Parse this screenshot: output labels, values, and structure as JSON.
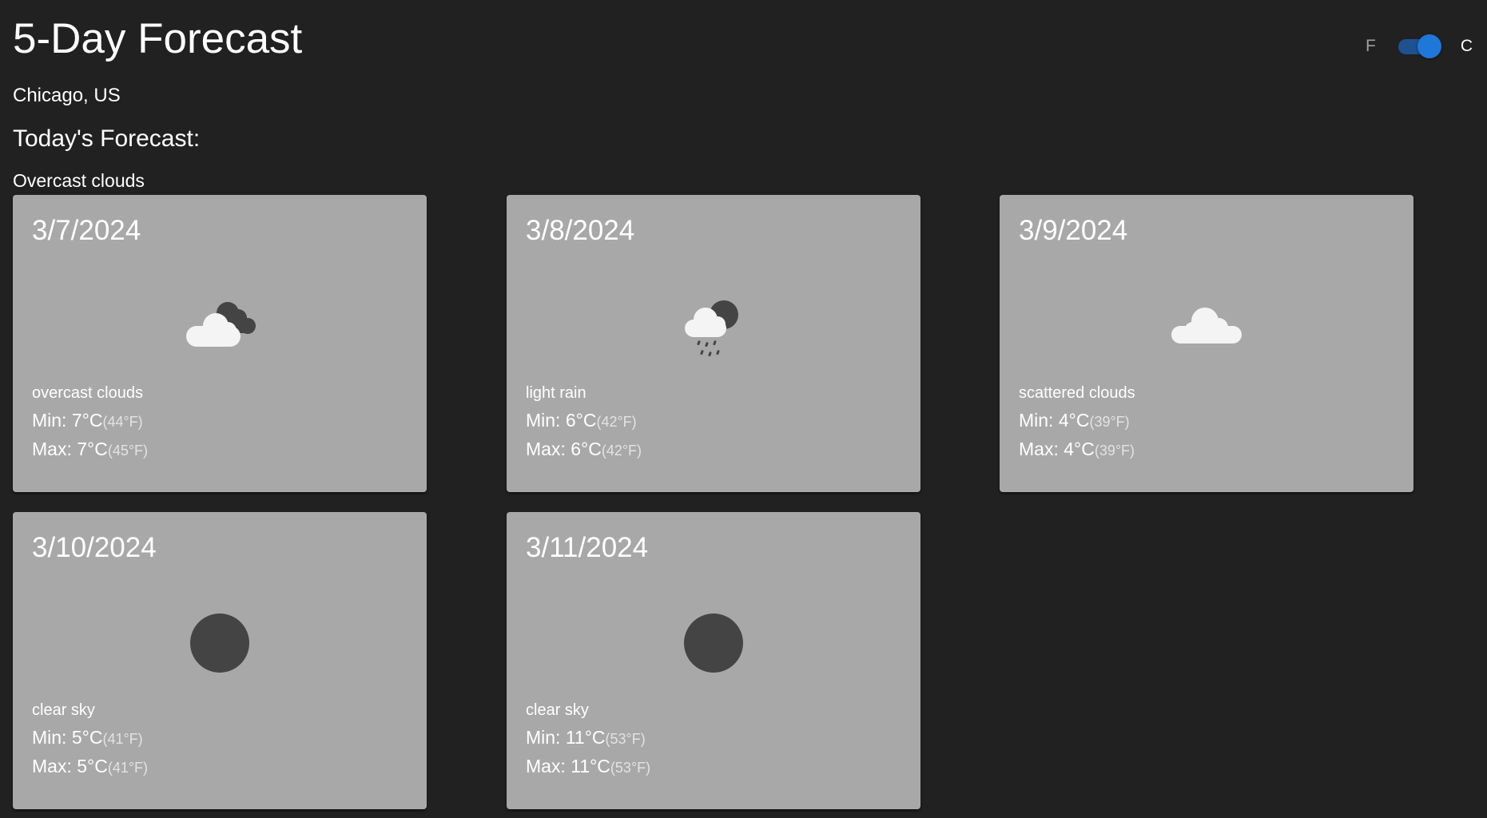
{
  "header": {
    "title": "5-Day Forecast",
    "location": "Chicago, US",
    "today_heading": "Today's Forecast:",
    "today_description": "Overcast clouds"
  },
  "unit_toggle": {
    "left_label": "F",
    "right_label": "C",
    "selected": "C",
    "accent_color": "#1f77d9"
  },
  "forecast": [
    {
      "date": "3/7/2024",
      "icon": "overcast-clouds-icon",
      "description": "overcast clouds",
      "min": "Min: 7°C",
      "min_f": "(44°F)",
      "max": "Max: 7°C",
      "max_f": "(45°F)"
    },
    {
      "date": "3/8/2024",
      "icon": "light-rain-icon",
      "description": "light rain",
      "min": "Min: 6°C",
      "min_f": "(42°F)",
      "max": "Max: 6°C",
      "max_f": "(42°F)"
    },
    {
      "date": "3/9/2024",
      "icon": "scattered-clouds-icon",
      "description": "scattered clouds",
      "min": "Min: 4°C",
      "min_f": "(39°F)",
      "max": "Max: 4°C",
      "max_f": "(39°F)"
    },
    {
      "date": "3/10/2024",
      "icon": "clear-sky-icon",
      "description": "clear sky",
      "min": "Min: 5°C",
      "min_f": "(41°F)",
      "max": "Max: 5°C",
      "max_f": "(41°F)"
    },
    {
      "date": "3/11/2024",
      "icon": "clear-sky-icon",
      "description": "clear sky",
      "min": "Min: 11°C",
      "min_f": "(53°F)",
      "max": "Max: 11°C",
      "max_f": "(53°F)"
    }
  ]
}
